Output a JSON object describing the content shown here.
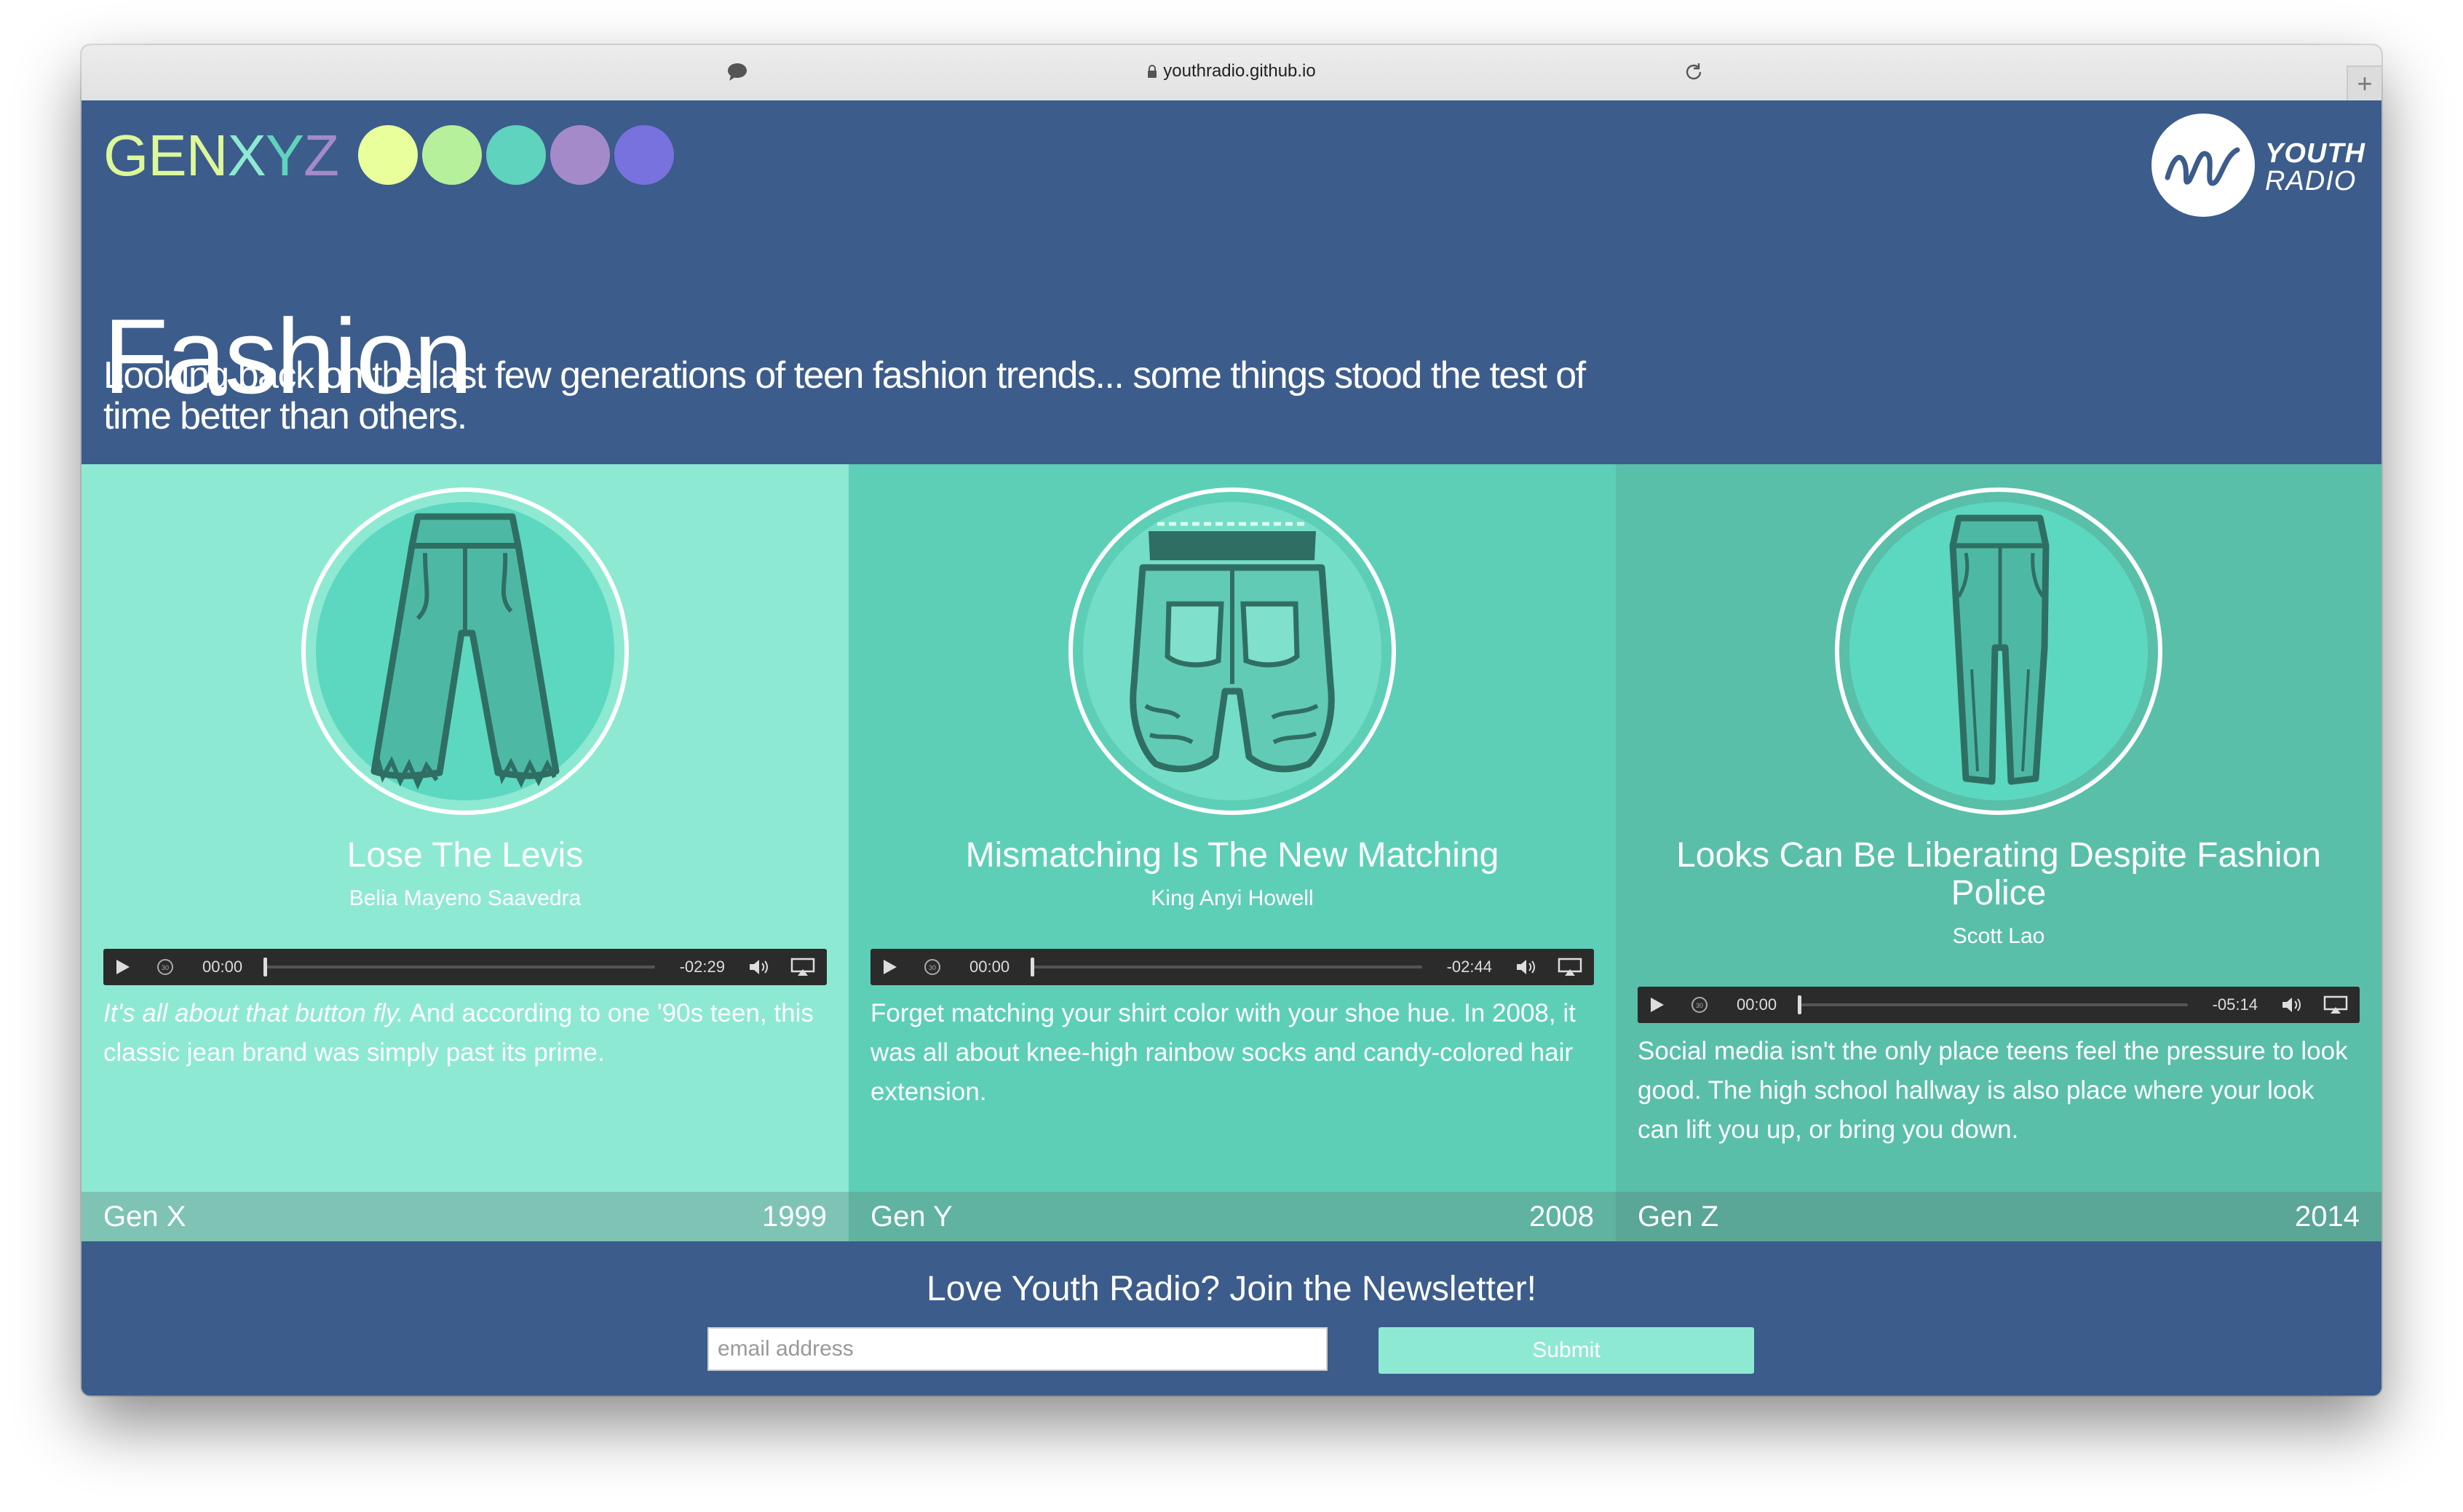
{
  "browser": {
    "url": "youthradio.github.io",
    "new_tab_label": "+"
  },
  "brand": {
    "letters": [
      "GEN",
      "X",
      "Y",
      "Z"
    ],
    "dot_colors": [
      "#e8ff9c",
      "#b6f09a",
      "#5fd3bd",
      "#a48ac9",
      "#7772dd"
    ],
    "partner_line1": "YOUTH",
    "partner_line2": "RADIO"
  },
  "page": {
    "title": "Fashion",
    "subtitle": "Looking back on the last few generations of teen fashion trends... some things stood the test of time better than others."
  },
  "stories": [
    {
      "title": "Lose The Levis",
      "author": "Belia Mayeno Saavedra",
      "player": {
        "current": "00:00",
        "remaining": "-02:29"
      },
      "desc_em": "It's all about that button fly.",
      "desc": "And according to one '90s teen, this classic jean brand was simply past its prime.",
      "generation": "Gen X",
      "year": "1999",
      "bg": "#8ee9d2",
      "footer_bg": "#7fc3b4",
      "icon": "wide-leg-jeans-icon"
    },
    {
      "title": "Mismatching Is The New Matching",
      "author": "King Anyi Howell",
      "player": {
        "current": "00:00",
        "remaining": "-02:44"
      },
      "desc_em": "",
      "desc": "Forget matching your shirt color with your shoe hue. In 2008, it was all about knee-high rainbow socks and candy-colored hair extension.",
      "generation": "Gen Y",
      "year": "2008",
      "bg": "#5dcfb7",
      "footer_bg": "#5fb3a0",
      "icon": "sagging-jeans-icon"
    },
    {
      "title": "Looks Can Be Liberating Despite Fashion Police",
      "author": "Scott Lao",
      "player": {
        "current": "00:00",
        "remaining": "-05:14"
      },
      "desc_em": "",
      "desc": "Social media isn't the only place teens feel the pressure to look good. The high school hallway is also place where your look can lift you up, or bring you down.",
      "generation": "Gen Z",
      "year": "2014",
      "bg": "#59bfa9",
      "footer_bg": "#5aa697",
      "icon": "skinny-jeans-icon"
    }
  ],
  "newsletter": {
    "heading": "Love Youth Radio? Join the Newsletter!",
    "email_placeholder": "email address",
    "submit_label": "Submit"
  }
}
